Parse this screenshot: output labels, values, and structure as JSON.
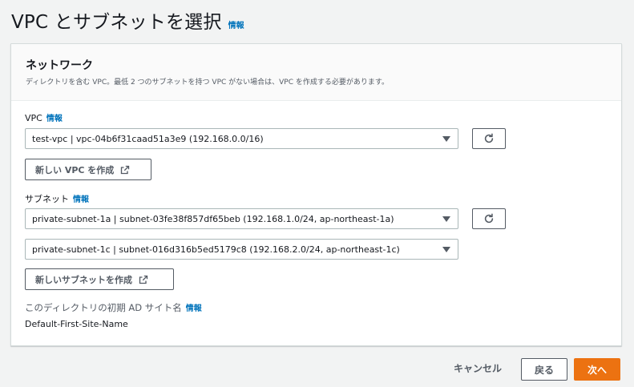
{
  "header": {
    "title": "VPC とサブネットを選択",
    "info": "情報"
  },
  "network": {
    "title": "ネットワーク",
    "description": "ディレクトリを含む VPC。最低 2 つのサブネットを持つ VPC がない場合は、VPC を作成する必要があります。",
    "vpc": {
      "label": "VPC",
      "info": "情報",
      "selected": "test-vpc | vpc-04b6f31caad51a3e9 (192.168.0.0/16)",
      "create_button": "新しい VPC を作成"
    },
    "subnets": {
      "label": "サブネット",
      "info": "情報",
      "subnet1": "private-subnet-1a | subnet-03fe38f857df65beb (192.168.1.0/24, ap-northeast-1a)",
      "subnet2": "private-subnet-1c | subnet-016d316b5ed5179c8 (192.168.2.0/24, ap-northeast-1c)",
      "create_button": "新しいサブネットを作成"
    },
    "ad_site": {
      "label": "このディレクトリの初期 AD サイト名",
      "info": "情報",
      "value": "Default-First-Site-Name"
    }
  },
  "footer": {
    "cancel": "キャンセル",
    "back": "戻る",
    "next": "次へ"
  },
  "colors": {
    "accent": "#ec7211",
    "link": "#0073bb"
  },
  "icons": {
    "refresh": "refresh-icon",
    "external": "external-link-icon",
    "caret": "caret-down-icon"
  }
}
